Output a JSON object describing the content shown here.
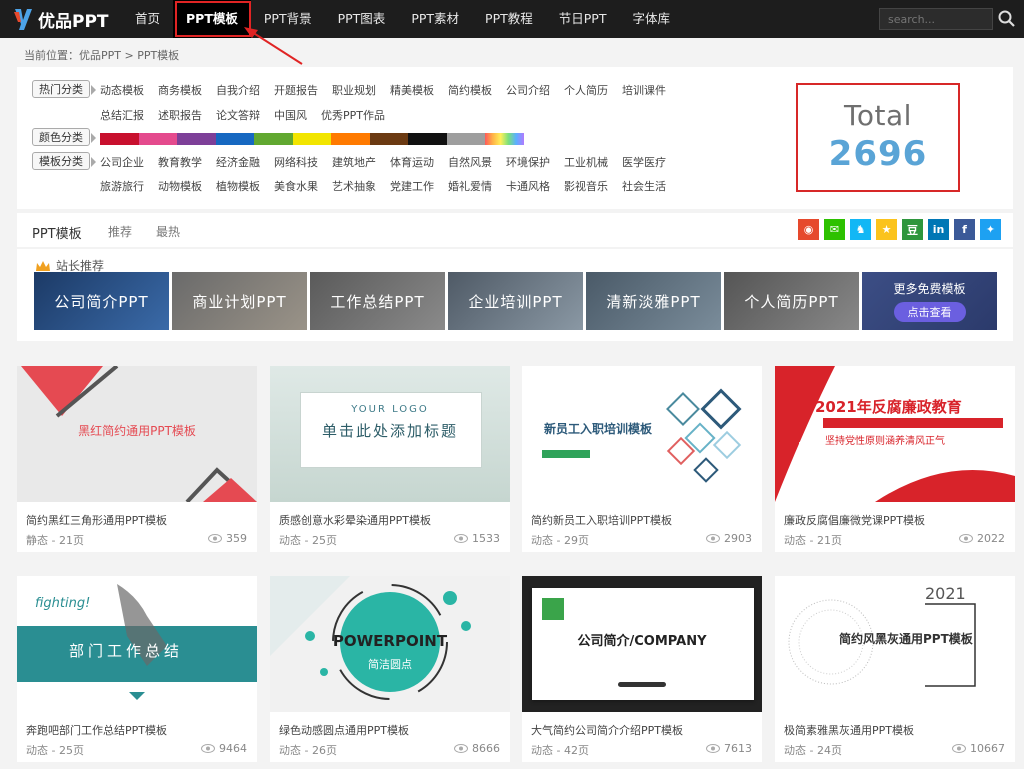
{
  "brand": {
    "name": "优品PPT"
  },
  "nav": [
    "首页",
    "PPT模板",
    "PPT背景",
    "PPT图表",
    "PPT素材",
    "PPT教程",
    "节日PPT",
    "字体库"
  ],
  "search": {
    "placeholder": "search..."
  },
  "breadcrumb": "当前位置：优品PPT > PPT模板",
  "filters": {
    "hot_label": "热门分类",
    "hot_row1": [
      "动态模板",
      "商务模板",
      "自我介绍",
      "开题报告",
      "职业规划",
      "精美模板",
      "简约模板",
      "公司介绍",
      "个人简历",
      "培训课件"
    ],
    "hot_row2": [
      "总结汇报",
      "述职报告",
      "论文答辩",
      "中国风",
      "优秀PPT作品"
    ],
    "color_label": "颜色分类",
    "colors": [
      "#c8102e",
      "#e44a8d",
      "#7d3f98",
      "#1668c1",
      "#61a830",
      "#f2e500",
      "#ff7a00",
      "#6b3a12",
      "#111111",
      "#9e9e9e",
      "rainbow"
    ],
    "style_label": "模板分类",
    "style_row1": [
      "公司企业",
      "教育教学",
      "经济金融",
      "网络科技",
      "建筑地产",
      "体育运动",
      "自然风景",
      "环境保护",
      "工业机械",
      "医学医疗"
    ],
    "style_row2": [
      "旅游旅行",
      "动物模板",
      "植物模板",
      "美食水果",
      "艺术抽象",
      "党建工作",
      "婚礼爱情",
      "卡通风格",
      "影视音乐",
      "社会生活"
    ]
  },
  "total": {
    "label": "Total",
    "value": "2696"
  },
  "tabs": {
    "main": "PPT模板",
    "recommend": "推荐",
    "latest": "最热"
  },
  "social": [
    {
      "icon": "weibo-icon",
      "color": "#e6492d",
      "glyph": "◉"
    },
    {
      "icon": "wechat-icon",
      "color": "#2dc100",
      "glyph": "✉"
    },
    {
      "icon": "qq-icon",
      "color": "#12b7f5",
      "glyph": "♞"
    },
    {
      "icon": "qzone-icon",
      "color": "#fbc31c",
      "glyph": "★"
    },
    {
      "icon": "douban-icon",
      "color": "#2e963d",
      "glyph": "豆"
    },
    {
      "icon": "linkedin-icon",
      "color": "#0077b5",
      "glyph": "in"
    },
    {
      "icon": "facebook-icon",
      "color": "#3b5998",
      "glyph": "f"
    },
    {
      "icon": "twitter-icon",
      "color": "#1da1f2",
      "glyph": "✦"
    }
  ],
  "recommend": {
    "title": "站长推荐",
    "banners": [
      "公司简介PPT",
      "商业计划PPT",
      "工作总结PPT",
      "企业培训PPT",
      "清新淡雅PPT",
      "个人简历PPT"
    ],
    "more": {
      "text": "更多免费模板",
      "button": "点击查看"
    }
  },
  "cards": [
    {
      "title": "简约黑红三角形通用PPT模板",
      "meta": "静态 - 21页",
      "views": "359",
      "thumb_text": "黑红简约通用PPT模板"
    },
    {
      "title": "质感创意水彩晕染通用PPT模板",
      "meta": "动态 - 25页",
      "views": "1533",
      "thumb_text": "单击此处添加标题",
      "thumb_sub": "YOUR LOGO"
    },
    {
      "title": "简约新员工入职培训PPT模板",
      "meta": "动态 - 29页",
      "views": "2903",
      "thumb_text": "新员工入职培训模板"
    },
    {
      "title": "廉政反腐倡廉微党课PPT模板",
      "meta": "动态 - 21页",
      "views": "2022",
      "thumb_text": "2021年反腐廉政教育",
      "thumb_sub": "坚持党性原则涵养清风正气"
    },
    {
      "title": "奔跑吧部门工作总结PPT模板",
      "meta": "动态 - 25页",
      "views": "9464",
      "thumb_text": "部门工作总结",
      "thumb_sub": "fighting!"
    },
    {
      "title": "绿色动感圆点通用PPT模板",
      "meta": "动态 - 26页",
      "views": "8666",
      "thumb_text": "POWERPOINT",
      "thumb_sub": "简洁圆点"
    },
    {
      "title": "大气简约公司简介介绍PPT模板",
      "meta": "动态 - 42页",
      "views": "7613",
      "thumb_text": "公司简介/COMPANY"
    },
    {
      "title": "极简素雅黑灰通用PPT模板",
      "meta": "动态 - 24页",
      "views": "10667",
      "thumb_text": "简约风黑灰通用PPT模板",
      "thumb_sub": "2021"
    }
  ]
}
